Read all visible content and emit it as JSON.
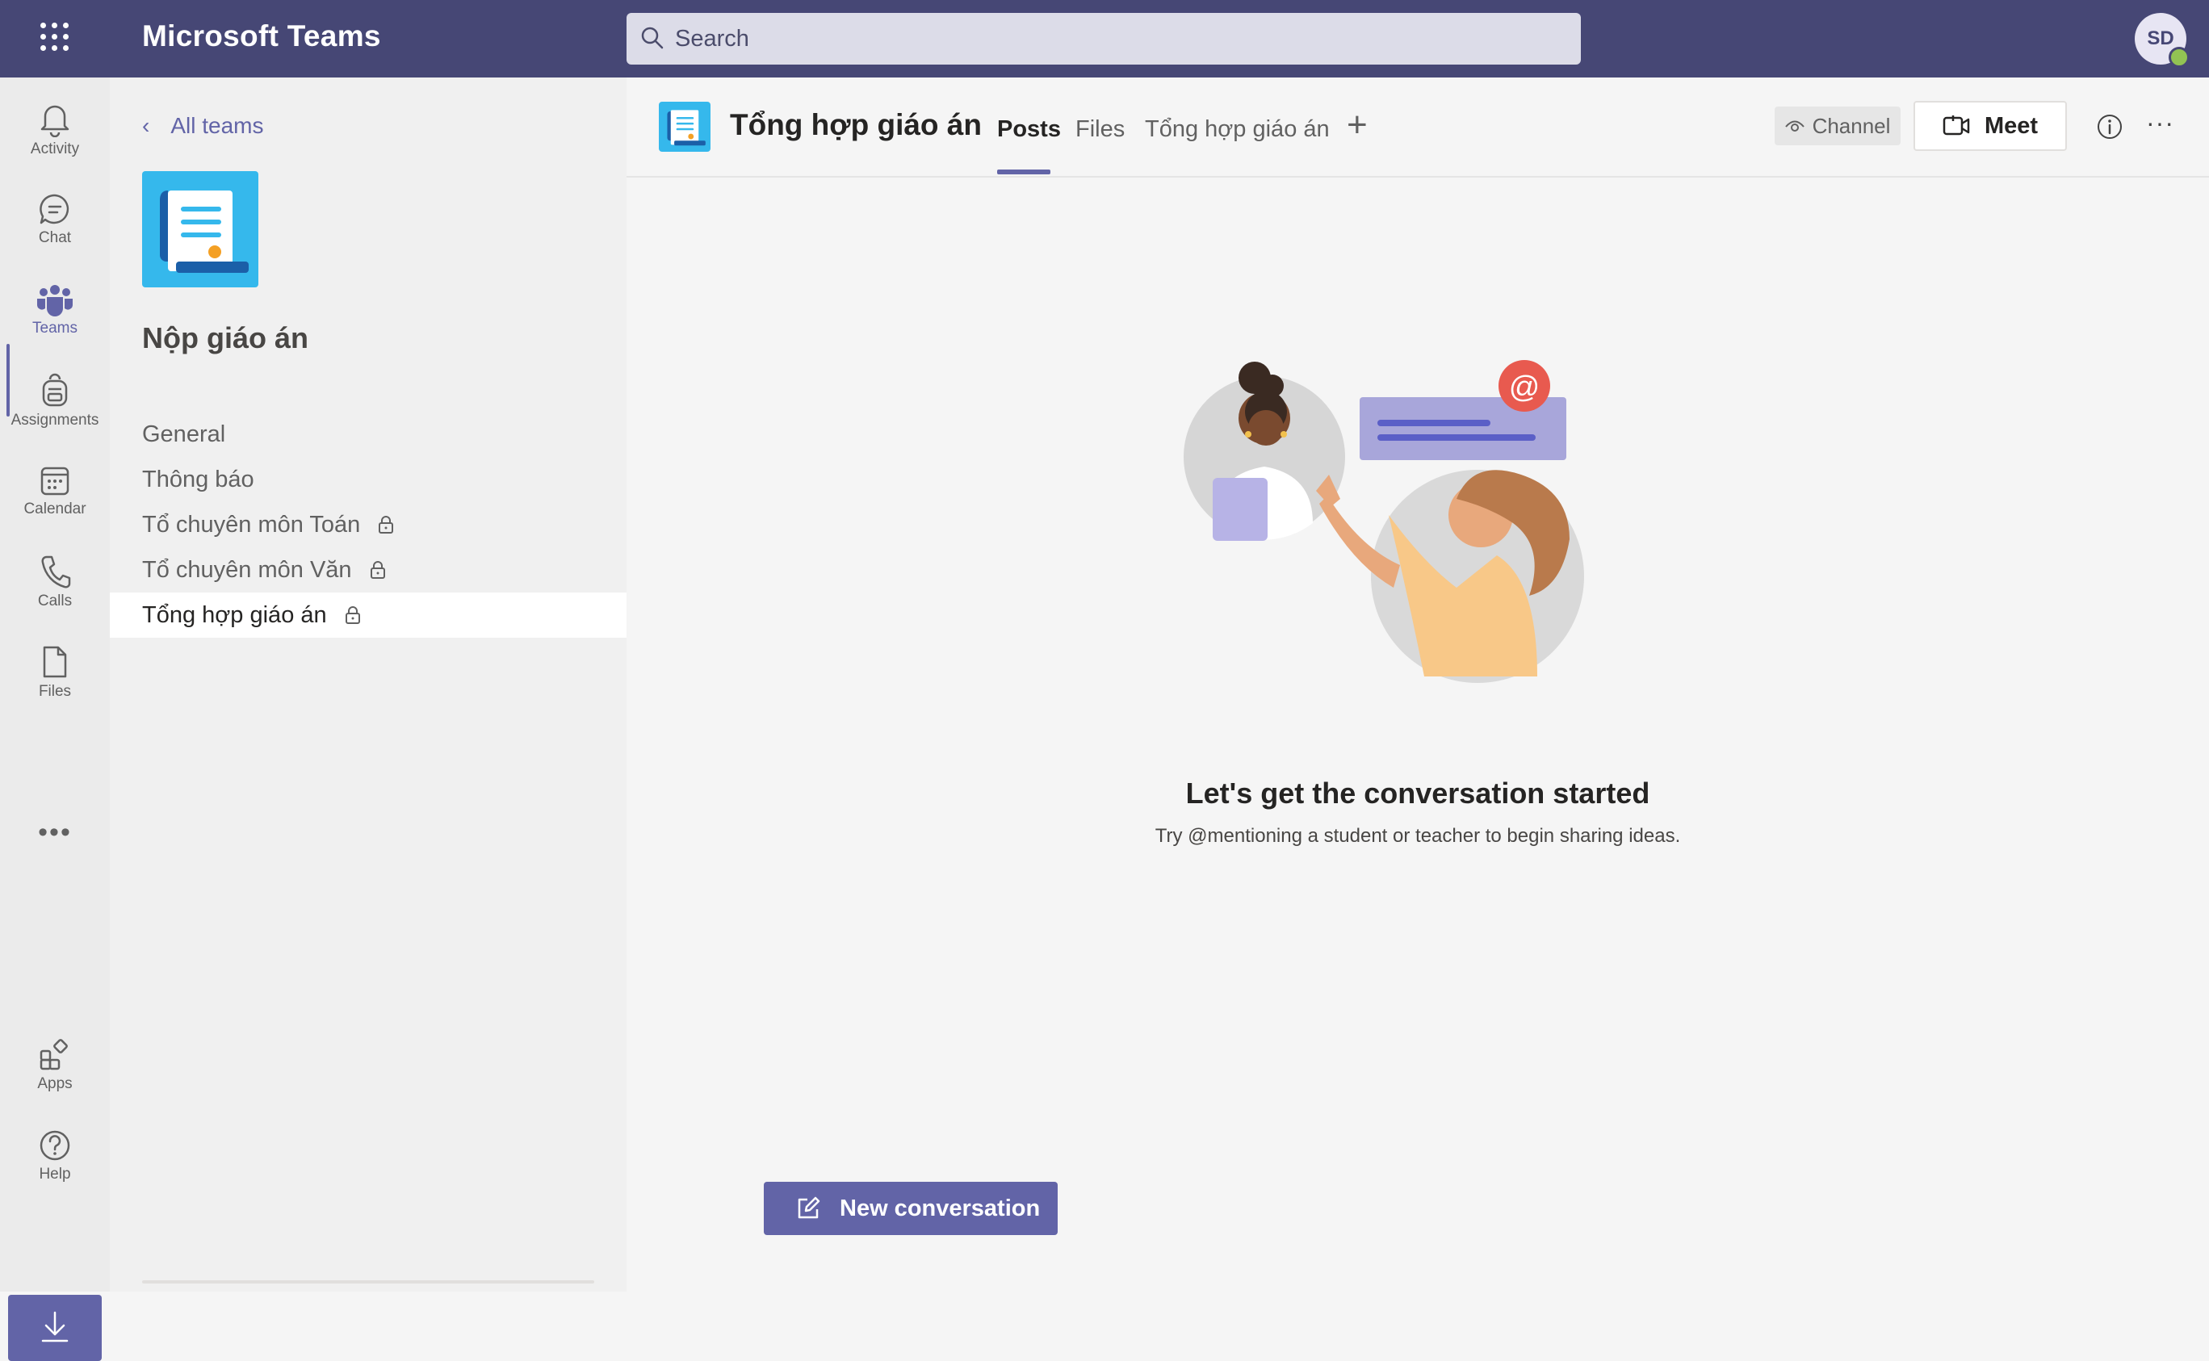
{
  "app": {
    "title": "Microsoft Teams",
    "search_placeholder": "Search",
    "user_initials": "SD",
    "accent_color": "#6264a7",
    "header_color": "#464775"
  },
  "rail": {
    "items": [
      {
        "label": "Activity",
        "icon": "bell-icon"
      },
      {
        "label": "Chat",
        "icon": "chat-icon"
      },
      {
        "label": "Teams",
        "icon": "teams-icon",
        "active": true
      },
      {
        "label": "Assignments",
        "icon": "backpack-icon"
      },
      {
        "label": "Calendar",
        "icon": "calendar-icon"
      },
      {
        "label": "Calls",
        "icon": "phone-icon"
      },
      {
        "label": "Files",
        "icon": "file-icon"
      }
    ],
    "more": "•••",
    "bottom_items": [
      {
        "label": "Apps",
        "icon": "apps-icon"
      },
      {
        "label": "Help",
        "icon": "help-icon"
      }
    ]
  },
  "panel": {
    "back_label": "All teams",
    "team_name": "Nộp giáo án",
    "channels": [
      {
        "name": "General",
        "locked": false
      },
      {
        "name": "Thông báo",
        "locked": false
      },
      {
        "name": "Tổ chuyên môn Toán",
        "locked": true
      },
      {
        "name": "Tổ chuyên môn Văn",
        "locked": true
      },
      {
        "name": "Tổng hợp giáo án",
        "locked": true,
        "selected": true
      }
    ]
  },
  "main": {
    "channel_title": "Tổng hợp giáo án",
    "tabs": [
      {
        "label": "Posts",
        "active": true
      },
      {
        "label": "Files"
      },
      {
        "label": "Tổng hợp giáo án"
      }
    ],
    "add_tab": "+",
    "channel_chip": "Channel",
    "meet_label": "Meet",
    "empty_title": "Let's get the conversation started",
    "empty_subtitle": "Try @mentioning a student or teacher to begin sharing ideas.",
    "new_conversation_label": "New conversation"
  }
}
